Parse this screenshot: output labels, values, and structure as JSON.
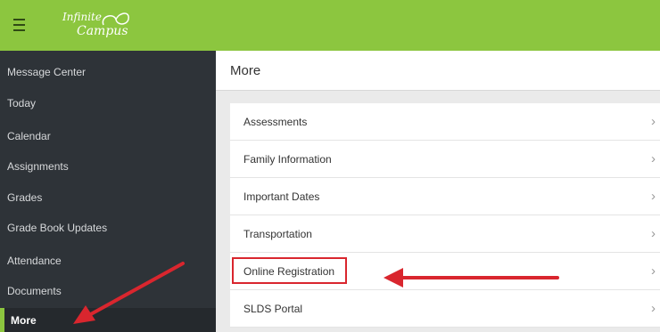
{
  "app": {
    "logo_top": "Infinite",
    "logo_bottom": "Campus"
  },
  "sidebar": {
    "items": [
      {
        "label": "Message Center"
      },
      {
        "label": "Today"
      },
      {
        "label": "Calendar"
      },
      {
        "label": "Assignments"
      },
      {
        "label": "Grades"
      },
      {
        "label": "Grade Book Updates"
      },
      {
        "label": "Attendance"
      },
      {
        "label": "Documents"
      },
      {
        "label": "More"
      }
    ],
    "active": "More"
  },
  "main": {
    "title": "More",
    "items": [
      {
        "label": "Assessments"
      },
      {
        "label": "Family Information"
      },
      {
        "label": "Important Dates"
      },
      {
        "label": "Transportation"
      },
      {
        "label": "Online Registration"
      },
      {
        "label": "SLDS Portal"
      }
    ],
    "chevron": "›"
  },
  "colors": {
    "brand_green": "#8cc63f",
    "sidebar_bg": "#2e3338",
    "annotation_red": "#d9262e"
  }
}
